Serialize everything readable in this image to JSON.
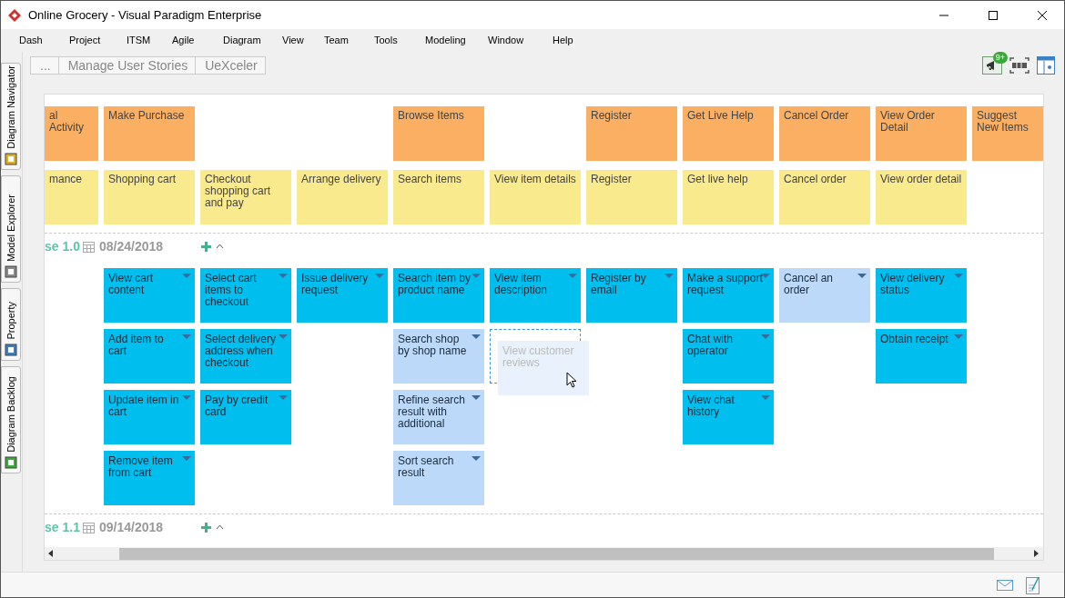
{
  "window": {
    "title": "Online Grocery - Visual Paradigm Enterprise"
  },
  "menu": [
    "Dash",
    "Project",
    "ITSM",
    "Agile",
    "Diagram",
    "View",
    "Team",
    "Tools",
    "Modeling",
    "Window",
    "Help"
  ],
  "breadcrumb": [
    "...",
    "Manage User Stories",
    "UeXceler"
  ],
  "toolbar": {
    "badge": "9+"
  },
  "side_tabs": [
    "Diagram Navigator",
    "Model Explorer",
    "Property",
    "Diagram Backlog"
  ],
  "releases": [
    {
      "name": "se 1.0",
      "date": "08/24/2018",
      "expanded": true
    },
    {
      "name": "se 1.1",
      "date": "09/14/2018",
      "expanded": true
    }
  ],
  "columns": [
    {
      "activity": "al Activity",
      "task": "mance"
    },
    {
      "activity": "Make Purchase",
      "task": "Shopping cart",
      "stories": [
        {
          "kind": "card",
          "color": "#00bfee",
          "text": "View cart content"
        },
        {
          "kind": "card",
          "color": "#00bfee",
          "text": "Add item to cart"
        },
        {
          "kind": "card",
          "color": "#00bfee",
          "text": "Update item in cart"
        },
        {
          "kind": "card",
          "color": "#00bfee",
          "text": "Remove item from cart"
        }
      ]
    },
    {
      "task": "Checkout shopping cart and pay",
      "stories": [
        {
          "kind": "card",
          "color": "#00bfee",
          "text": "Select cart items to checkout"
        },
        {
          "kind": "card",
          "color": "#00bfee",
          "text": "Select delivery address when checkout"
        },
        {
          "kind": "card",
          "color": "#00bfee",
          "text": "Pay by credit card"
        }
      ]
    },
    {
      "task": "Arrange delivery",
      "stories": [
        {
          "kind": "card",
          "color": "#00bfee",
          "text": "Issue delivery request"
        }
      ]
    },
    {
      "activity": "Browse Items",
      "task": "Search items",
      "stories": [
        {
          "kind": "card",
          "color": "#00bfee",
          "text": "Search item by product name"
        },
        {
          "kind": "card",
          "color": "#bcd9fa",
          "text": "Search shop by shop name"
        },
        {
          "kind": "card",
          "color": "#bcd9fa",
          "text": "Refine search result with additional"
        },
        {
          "kind": "card",
          "color": "#bcd9fa",
          "text": "Sort search result"
        }
      ]
    },
    {
      "task": "View item details",
      "stories": [
        {
          "kind": "card",
          "color": "#00bfee",
          "text": "View item description"
        },
        {
          "kind": "dragging",
          "color": "#e8f1fc",
          "text": "View customer reviews"
        }
      ]
    },
    {
      "activity": "Register",
      "task": "Register",
      "stories": [
        {
          "kind": "card",
          "color": "#00bfee",
          "text": "Register by email"
        }
      ]
    },
    {
      "activity": "Get Live Help",
      "task": "Get live help",
      "stories": [
        {
          "kind": "card",
          "color": "#00bfee",
          "text": "Make a support request"
        },
        {
          "kind": "card",
          "color": "#00bfee",
          "text": "Chat with operator"
        },
        {
          "kind": "card",
          "color": "#00bfee",
          "text": "View chat history"
        }
      ]
    },
    {
      "activity": "Cancel Order",
      "task": "Cancel order",
      "stories": [
        {
          "kind": "card",
          "color": "#bcd9fa",
          "text": "Cancel an order"
        }
      ]
    },
    {
      "activity": "View Order Detail",
      "task": "View order detail",
      "stories": [
        {
          "kind": "card",
          "color": "#00bfee",
          "text": "View delivery status"
        },
        {
          "kind": "card",
          "color": "#00bfee",
          "text": "Obtain receipt"
        }
      ]
    },
    {
      "activity": "Suggest New Items"
    }
  ]
}
